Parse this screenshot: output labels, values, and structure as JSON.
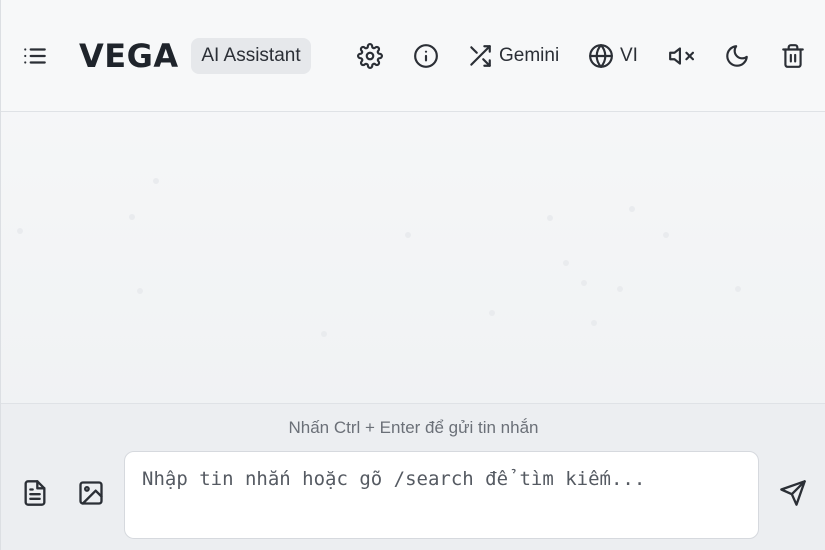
{
  "header": {
    "menu_icon": "list-icon",
    "logo": "VEGA",
    "badge": "AI Assistant",
    "settings_icon": "gear-icon",
    "info_icon": "info-icon",
    "model_icon": "shuffle-icon",
    "model_label": "Gemini",
    "language_icon": "globe-icon",
    "language_label": "VI",
    "sound_icon": "volume-mute-icon",
    "theme_icon": "moon-icon",
    "clear_icon": "trash-icon"
  },
  "footer": {
    "hint": "Nhấn Ctrl + Enter để gửi tin nhắn",
    "input_placeholder": "Nhập tin nhắn hoặc gõ /search để tìm kiếm...",
    "input_value": "",
    "document_icon": "file-text-icon",
    "image_icon": "image-icon",
    "send_icon": "send-icon"
  },
  "colors": {
    "background": "#f7f8f9",
    "text": "#2b2f36",
    "badge_bg": "#e6e8eb",
    "hint": "#6b7078"
  }
}
